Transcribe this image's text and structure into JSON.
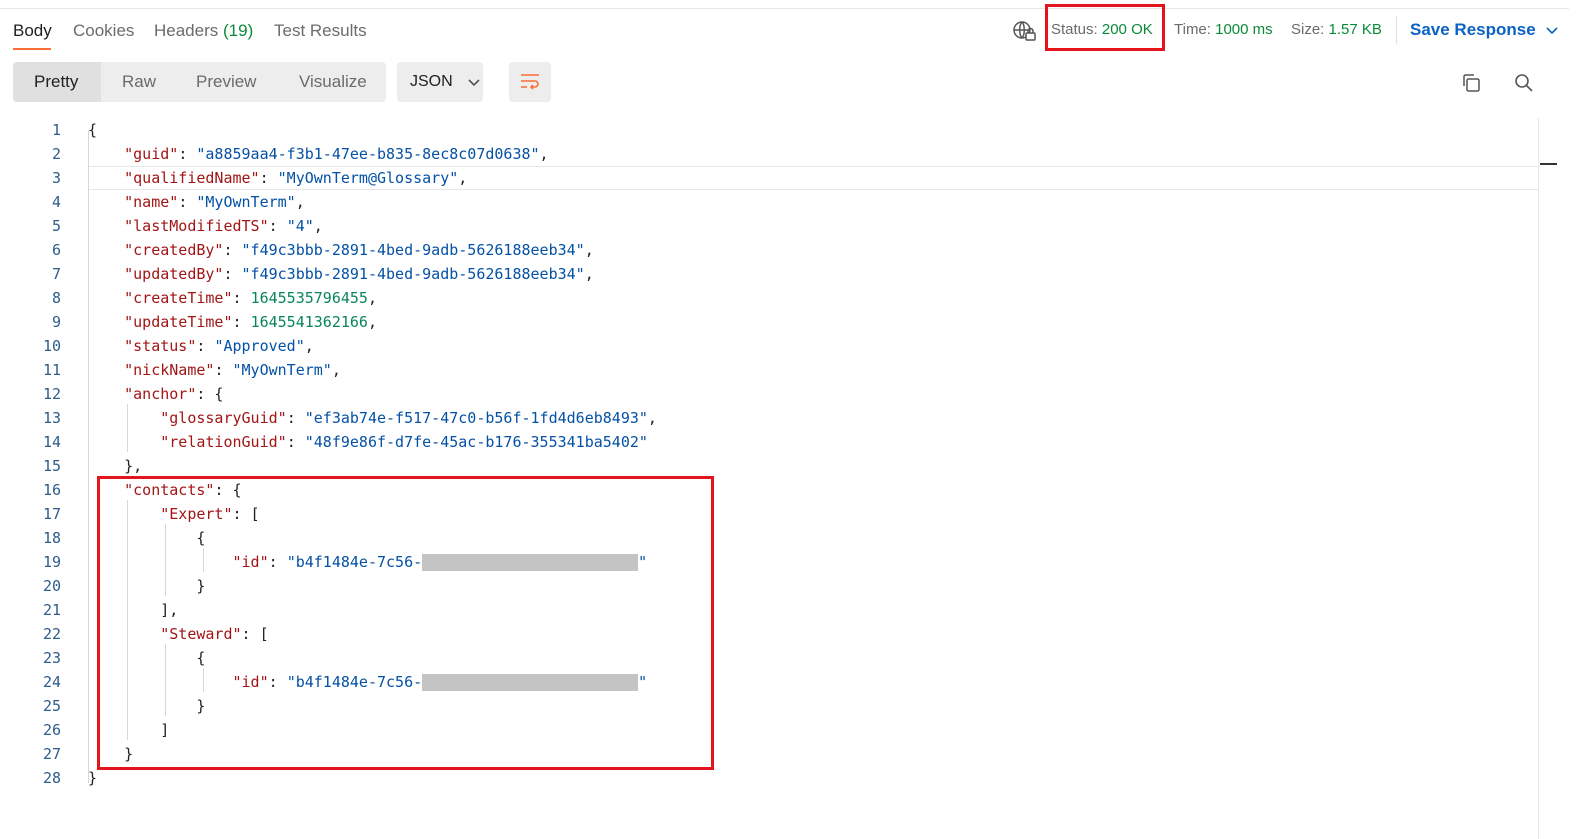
{
  "tabs": [
    {
      "label": "Body"
    },
    {
      "label": "Cookies"
    },
    {
      "label": "Headers",
      "count": "(19)"
    },
    {
      "label": "Test Results"
    }
  ],
  "response_meta": {
    "status_label": "Status:",
    "status_value": "200 OK",
    "time_label": "Time:",
    "time_value": "1000 ms",
    "size_label": "Size:",
    "size_value": "1.57 KB",
    "save_label": "Save Response"
  },
  "view_modes": [
    {
      "label": "Pretty",
      "active": true
    },
    {
      "label": "Raw"
    },
    {
      "label": "Preview"
    },
    {
      "label": "Visualize"
    }
  ],
  "format": {
    "selected": "JSON"
  },
  "icons": {
    "network": "globe-lock-icon",
    "copy": "copy-icon",
    "search": "search-icon",
    "wrap": "wrap-lines-icon",
    "chevron": "chevron-down-icon"
  },
  "colors": {
    "accent": "#ff6c37",
    "status_ok": "#0c8a3a",
    "link": "#0b62c4",
    "highlight": "#e4141c",
    "json_key": "#a31515",
    "json_string": "#0451a5",
    "json_number": "#098658"
  },
  "code_lines": [
    {
      "n": "1",
      "indent": 0,
      "tokens": [
        [
          "p",
          "{"
        ]
      ]
    },
    {
      "n": "2",
      "indent": 1,
      "tokens": [
        [
          "k",
          "\"guid\""
        ],
        [
          "p",
          ": "
        ],
        [
          "s",
          "\"a8859aa4-f3b1-47ee-b835-8ec8c07d0638\""
        ],
        [
          "p",
          ","
        ]
      ]
    },
    {
      "n": "3",
      "indent": 1,
      "tokens": [
        [
          "k",
          "\"qualifiedName\""
        ],
        [
          "p",
          ": "
        ],
        [
          "s",
          "\"MyOwnTerm@Glossary\""
        ],
        [
          "p",
          ","
        ]
      ]
    },
    {
      "n": "4",
      "indent": 1,
      "tokens": [
        [
          "k",
          "\"name\""
        ],
        [
          "p",
          ": "
        ],
        [
          "s",
          "\"MyOwnTerm\""
        ],
        [
          "p",
          ","
        ]
      ]
    },
    {
      "n": "5",
      "indent": 1,
      "tokens": [
        [
          "k",
          "\"lastModifiedTS\""
        ],
        [
          "p",
          ": "
        ],
        [
          "s",
          "\"4\""
        ],
        [
          "p",
          ","
        ]
      ]
    },
    {
      "n": "6",
      "indent": 1,
      "tokens": [
        [
          "k",
          "\"createdBy\""
        ],
        [
          "p",
          ": "
        ],
        [
          "s",
          "\"f49c3bbb-2891-4bed-9adb-5626188eeb34\""
        ],
        [
          "p",
          ","
        ]
      ]
    },
    {
      "n": "7",
      "indent": 1,
      "tokens": [
        [
          "k",
          "\"updatedBy\""
        ],
        [
          "p",
          ": "
        ],
        [
          "s",
          "\"f49c3bbb-2891-4bed-9adb-5626188eeb34\""
        ],
        [
          "p",
          ","
        ]
      ]
    },
    {
      "n": "8",
      "indent": 1,
      "tokens": [
        [
          "k",
          "\"createTime\""
        ],
        [
          "p",
          ": "
        ],
        [
          "n",
          "1645535796455"
        ],
        [
          "p",
          ","
        ]
      ]
    },
    {
      "n": "9",
      "indent": 1,
      "tokens": [
        [
          "k",
          "\"updateTime\""
        ],
        [
          "p",
          ": "
        ],
        [
          "n",
          "1645541362166"
        ],
        [
          "p",
          ","
        ]
      ]
    },
    {
      "n": "10",
      "indent": 1,
      "tokens": [
        [
          "k",
          "\"status\""
        ],
        [
          "p",
          ": "
        ],
        [
          "s",
          "\"Approved\""
        ],
        [
          "p",
          ","
        ]
      ]
    },
    {
      "n": "11",
      "indent": 1,
      "tokens": [
        [
          "k",
          "\"nickName\""
        ],
        [
          "p",
          ": "
        ],
        [
          "s",
          "\"MyOwnTerm\""
        ],
        [
          "p",
          ","
        ]
      ]
    },
    {
      "n": "12",
      "indent": 1,
      "tokens": [
        [
          "k",
          "\"anchor\""
        ],
        [
          "p",
          ": {"
        ]
      ]
    },
    {
      "n": "13",
      "indent": 2,
      "tokens": [
        [
          "k",
          "\"glossaryGuid\""
        ],
        [
          "p",
          ": "
        ],
        [
          "s",
          "\"ef3ab74e-f517-47c0-b56f-1fd4d6eb8493\""
        ],
        [
          "p",
          ","
        ]
      ]
    },
    {
      "n": "14",
      "indent": 2,
      "tokens": [
        [
          "k",
          "\"relationGuid\""
        ],
        [
          "p",
          ": "
        ],
        [
          "s",
          "\"48f9e86f-d7fe-45ac-b176-355341ba5402\""
        ]
      ]
    },
    {
      "n": "15",
      "indent": 1,
      "tokens": [
        [
          "p",
          "},"
        ]
      ]
    },
    {
      "n": "16",
      "indent": 1,
      "tokens": [
        [
          "k",
          "\"contacts\""
        ],
        [
          "p",
          ": {"
        ]
      ]
    },
    {
      "n": "17",
      "indent": 2,
      "tokens": [
        [
          "k",
          "\"Expert\""
        ],
        [
          "p",
          ": ["
        ]
      ]
    },
    {
      "n": "18",
      "indent": 3,
      "tokens": [
        [
          "p",
          "{"
        ]
      ]
    },
    {
      "n": "19",
      "indent": 4,
      "tokens": [
        [
          "k",
          "\"id\""
        ],
        [
          "p",
          ": "
        ],
        [
          "s",
          "\"b4f1484e-7c56-"
        ],
        [
          "r",
          ""
        ],
        [
          "s",
          "\""
        ]
      ]
    },
    {
      "n": "20",
      "indent": 3,
      "tokens": [
        [
          "p",
          "}"
        ]
      ]
    },
    {
      "n": "21",
      "indent": 2,
      "tokens": [
        [
          "p",
          "],"
        ]
      ]
    },
    {
      "n": "22",
      "indent": 2,
      "tokens": [
        [
          "k",
          "\"Steward\""
        ],
        [
          "p",
          ": ["
        ]
      ]
    },
    {
      "n": "23",
      "indent": 3,
      "tokens": [
        [
          "p",
          "{"
        ]
      ]
    },
    {
      "n": "24",
      "indent": 4,
      "tokens": [
        [
          "k",
          "\"id\""
        ],
        [
          "p",
          ": "
        ],
        [
          "s",
          "\"b4f1484e-7c56-"
        ],
        [
          "r",
          ""
        ],
        [
          "s",
          "\""
        ]
      ]
    },
    {
      "n": "25",
      "indent": 3,
      "tokens": [
        [
          "p",
          "}"
        ]
      ]
    },
    {
      "n": "26",
      "indent": 2,
      "tokens": [
        [
          "p",
          "]"
        ]
      ]
    },
    {
      "n": "27",
      "indent": 1,
      "tokens": [
        [
          "p",
          "}"
        ]
      ]
    },
    {
      "n": "28",
      "indent": 0,
      "tokens": [
        [
          "p",
          "}"
        ]
      ]
    }
  ]
}
